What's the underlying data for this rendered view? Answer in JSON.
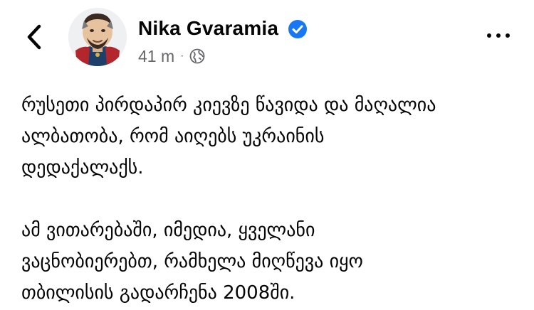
{
  "post": {
    "author": {
      "name": "Nika Gvaramia",
      "verified": true,
      "avatar_icon": "cartoon-avatar-icon"
    },
    "timestamp": "41 m",
    "separator": "·",
    "audience_icon": "globe-icon",
    "paragraphs": [
      "რუსეთი პირდაპირ კიევზე წავიდა და მაღალია\nალბათობა, რომ აიღებს უკრაინის\nდედაქალაქს.",
      "ამ ვითარებაში, იმედია, ყველანი\nვაცნობიერებთ, რამხელა მიღწევა იყო\nთბილისის გადარჩენა 2008ში."
    ]
  },
  "colors": {
    "text": "#050505",
    "secondary_text": "#65676b",
    "verified_badge": "#1877f2"
  },
  "icons": {
    "back": "chevron-left-icon",
    "more": "more-options-icon",
    "verified": "verified-badge-icon"
  }
}
